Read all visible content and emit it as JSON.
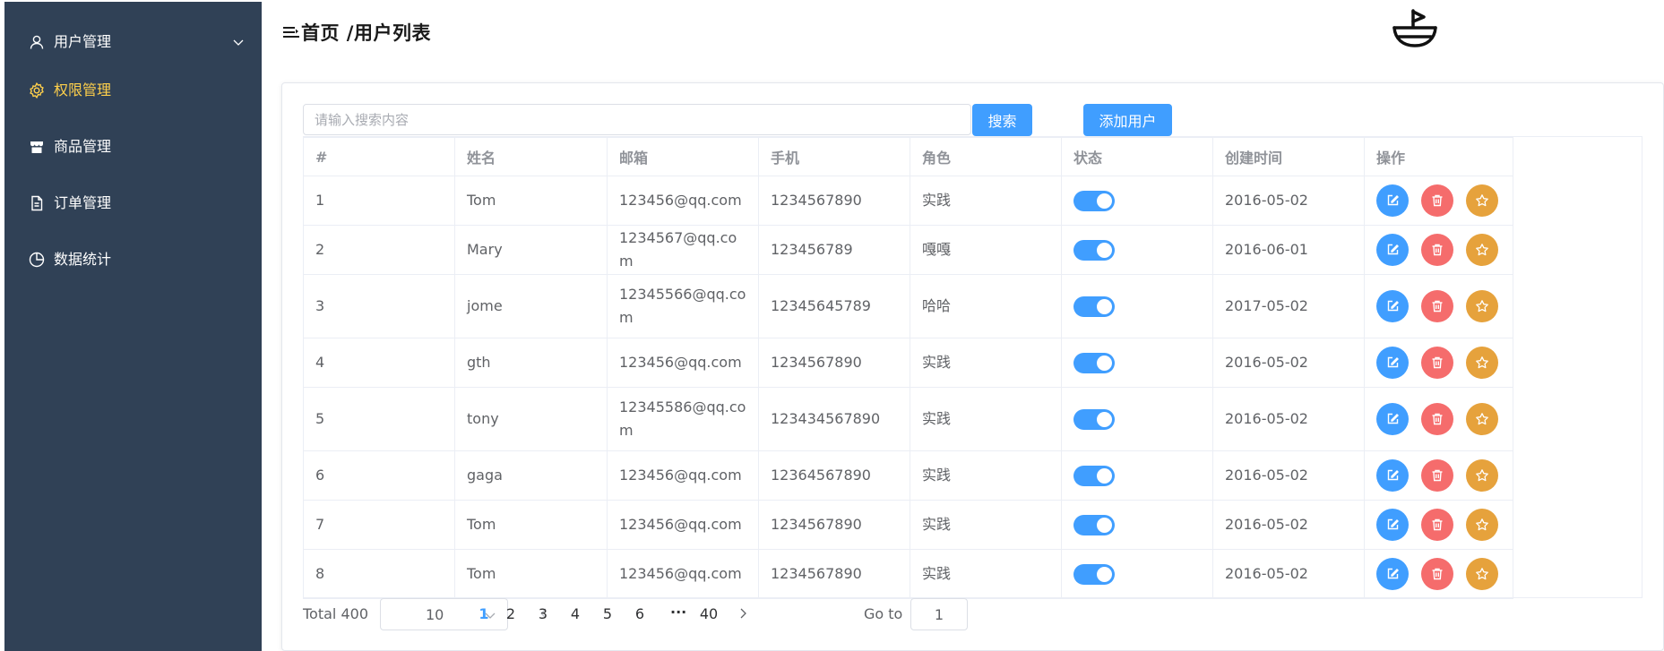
{
  "sidebar": {
    "items": [
      {
        "label": "用户管理",
        "icon": "user-icon",
        "has_arrow": true
      },
      {
        "label": "权限管理",
        "icon": "gear-icon",
        "active": true
      },
      {
        "label": "商品管理",
        "icon": "shop-icon"
      },
      {
        "label": "订单管理",
        "icon": "document-icon"
      },
      {
        "label": "数据统计",
        "icon": "pie-chart-icon"
      }
    ],
    "active_color": "#ffd04b",
    "background": "#304156"
  },
  "header": {
    "breadcrumb": "首页 /用户列表",
    "toggle_icon": "menu-fold-icon",
    "logo_icon": "boat-logo-icon"
  },
  "toolbar": {
    "search_placeholder": "请输入搜索内容",
    "search_value": "",
    "search_label": "搜索",
    "add_label": "添加用户"
  },
  "table": {
    "headers": [
      "#",
      "姓名",
      "邮箱",
      "手机",
      "角色",
      "状态",
      "创建时间",
      "操作"
    ],
    "rows": [
      {
        "index": "1",
        "name": "Tom",
        "email": "123456@qq.com",
        "phone": "1234567890",
        "role": "实践",
        "status": true,
        "date": "2016-05-02"
      },
      {
        "index": "2",
        "name": "Mary",
        "email": "1234567@qq.com",
        "phone": "123456789",
        "role": "嘎嘎",
        "status": true,
        "date": "2016-06-01"
      },
      {
        "index": "3",
        "name": "jome",
        "email": "12345566@qq.com",
        "phone": "12345645789",
        "role": "哈哈",
        "status": true,
        "date": "2017-05-02"
      },
      {
        "index": "4",
        "name": "gth",
        "email": "123456@qq.com",
        "phone": "1234567890",
        "role": "实践",
        "status": true,
        "date": "2016-05-02"
      },
      {
        "index": "5",
        "name": "tony",
        "email": "12345586@qq.com",
        "phone": "123434567890",
        "role": "实践",
        "status": true,
        "date": "2016-05-02"
      },
      {
        "index": "6",
        "name": "gaga",
        "email": "123456@qq.com",
        "phone": "12364567890",
        "role": "实践",
        "status": true,
        "date": "2016-05-02"
      },
      {
        "index": "7",
        "name": "Tom",
        "email": "123456@qq.com",
        "phone": "1234567890",
        "role": "实践",
        "status": true,
        "date": "2016-05-02"
      },
      {
        "index": "8",
        "name": "Tom",
        "email": "123456@qq.com",
        "phone": "1234567890",
        "role": "实践",
        "status": true,
        "date": "2016-05-02"
      }
    ],
    "action_icons": [
      "edit-icon",
      "delete-icon",
      "star-icon"
    ],
    "action_colors": {
      "edit": "#409eff",
      "delete": "#f56c6c",
      "star": "#e6a23c"
    },
    "switch_on_color": "#409eff"
  },
  "pagination": {
    "total_label": "Total 400",
    "page_size": "10",
    "pages": [
      "1",
      "2",
      "3",
      "4",
      "5",
      "6"
    ],
    "current_page": "1",
    "more": "···",
    "last_page": "40",
    "goto_label": "Go to",
    "goto_value": "1"
  }
}
